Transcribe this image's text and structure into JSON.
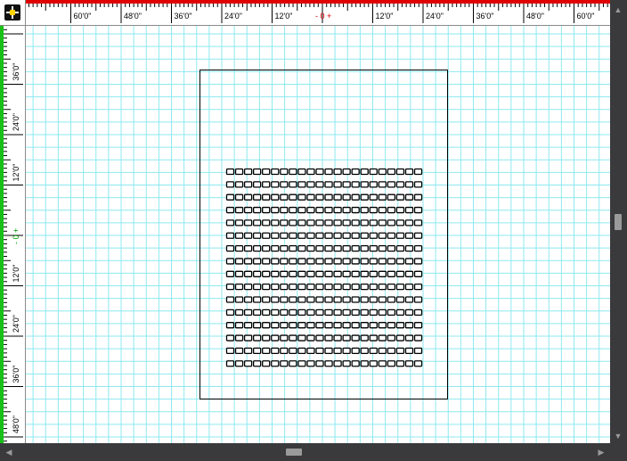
{
  "rulers": {
    "horizontal": {
      "origin_label": "0",
      "labels": [
        "60'0\"",
        "48'0\"",
        "36'0\"",
        "24'0\"",
        "12'0\"",
        "12'0\"",
        "24'0\"",
        "36'0\"",
        "48'0\"",
        "60'0\""
      ]
    },
    "vertical": {
      "origin_label": "0",
      "labels": [
        "36'0\"",
        "24'0\"",
        "12'0\"",
        "12'0\"",
        "24'0\"",
        "36'0\"",
        "48'0\""
      ]
    }
  },
  "grid": {
    "rows": 16,
    "columns": 22
  },
  "colors": {
    "grid_line": "#8ee9f0",
    "ruler_bar_horizontal": "#e00000",
    "ruler_bar_vertical": "#18c018",
    "origin_horizontal": "#e00000",
    "origin_vertical": "#00a000",
    "scrollbar_track": "#3a3a3c",
    "scrollbar_thumb": "#9a9a9a"
  },
  "icons": {
    "corner": "crosshair-origin-icon",
    "scroll_up": "triangle-up-icon",
    "scroll_down": "triangle-down-icon",
    "scroll_left": "triangle-left-icon",
    "scroll_right": "triangle-right-icon"
  }
}
